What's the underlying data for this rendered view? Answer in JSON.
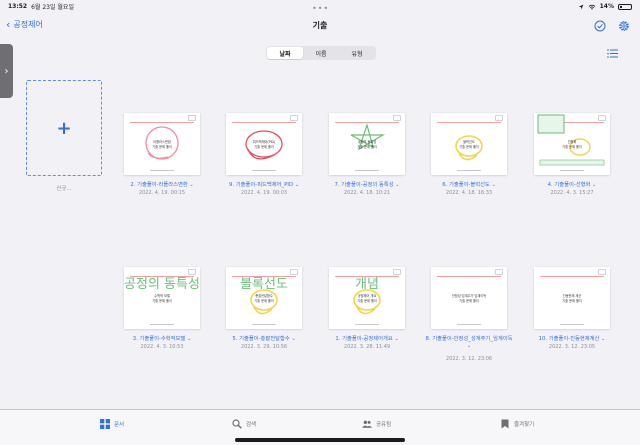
{
  "status": {
    "time": "13:52",
    "date": "6월 23일 월요일",
    "battery": "14%"
  },
  "nav": {
    "back_label": "공정제어",
    "title": "기출",
    "icons": [
      "checkmark-circle-icon",
      "gear-icon"
    ]
  },
  "segments": [
    {
      "label": "날짜",
      "active": true
    },
    {
      "label": "이름",
      "active": false
    },
    {
      "label": "유형",
      "active": false
    }
  ],
  "new_doc_label": "신규...",
  "docs": [
    {
      "title": "2. 기출풀이-라플라스변환",
      "date": "2022. 4. 19. 00:15",
      "note1": "라플라스변환",
      "note2": "기출 문제 풀이",
      "ink": "pink"
    },
    {
      "title": "9. 기출풀이-피드백제어_PID",
      "date": "2022. 4. 19. 00:03",
      "note1": "피드백제어(PID)",
      "note2": "기출 문제 풀이",
      "ink": "red"
    },
    {
      "title": "7. 기출풀이-공정의 동특성",
      "date": "2022. 4. 18. 10:21",
      "note1": "공정의 동특성",
      "note2": "기출 문제 풀이",
      "ink": "green-star"
    },
    {
      "title": "6. 기출풀이-블럭선도",
      "date": "2022. 4. 18. 16:33",
      "note1": "블럭선도",
      "note2": "기출 문제 풀이",
      "ink": "yellow"
    },
    {
      "title": "4. 기출풀이-선형화",
      "date": "2022. 4. 3. 15:27",
      "note1": "선형화",
      "note2": "기출 문제 풀이",
      "ink": "green-box"
    },
    {
      "title": "3. 기출풀이-수학적모델",
      "date": "2022. 4. 3. 10:53",
      "big": "공정의 동특성",
      "note1": "수학적 모델",
      "note2": "기출 문제 풀이",
      "ink": "none"
    },
    {
      "title": "5. 기출풀이-총괄전달함수",
      "date": "2022. 3. 29. 10:56",
      "big": "블록선도",
      "note1": "총괄전달함수",
      "note2": "기출 문제 풀이",
      "ink": "yellow"
    },
    {
      "title": "1. 기출풀이-공정제어개요",
      "date": "2022. 3. 28. 11:49",
      "big": "개념",
      "note1": "공정제어 개요",
      "note2": "기출 문제 풀이",
      "ink": "yellow"
    },
    {
      "title": "8. 기출풀이-안정성_성계주기_임계이득",
      "date": "2022. 3. 12. 23:06",
      "note1": "안정성·임계주기·임계이득",
      "note2": "기출 문제 풀이",
      "ink": "none"
    },
    {
      "title": "10. 기출풀이-진동현제계산",
      "date": "2022. 3. 12. 23:05",
      "note1": "진동현제 계산",
      "note2": "기출 문제 풀이",
      "ink": "none"
    }
  ],
  "tabs": [
    {
      "label": "문서",
      "icon": "grid-icon",
      "active": true
    },
    {
      "label": "검색",
      "icon": "search-icon",
      "active": false
    },
    {
      "label": "공유됨",
      "icon": "people-icon",
      "active": false
    },
    {
      "label": "즐겨찾기",
      "icon": "bookmark-icon",
      "active": false
    }
  ],
  "colors": {
    "accent": "#2f6fe0",
    "background": "#f2f2f6"
  }
}
